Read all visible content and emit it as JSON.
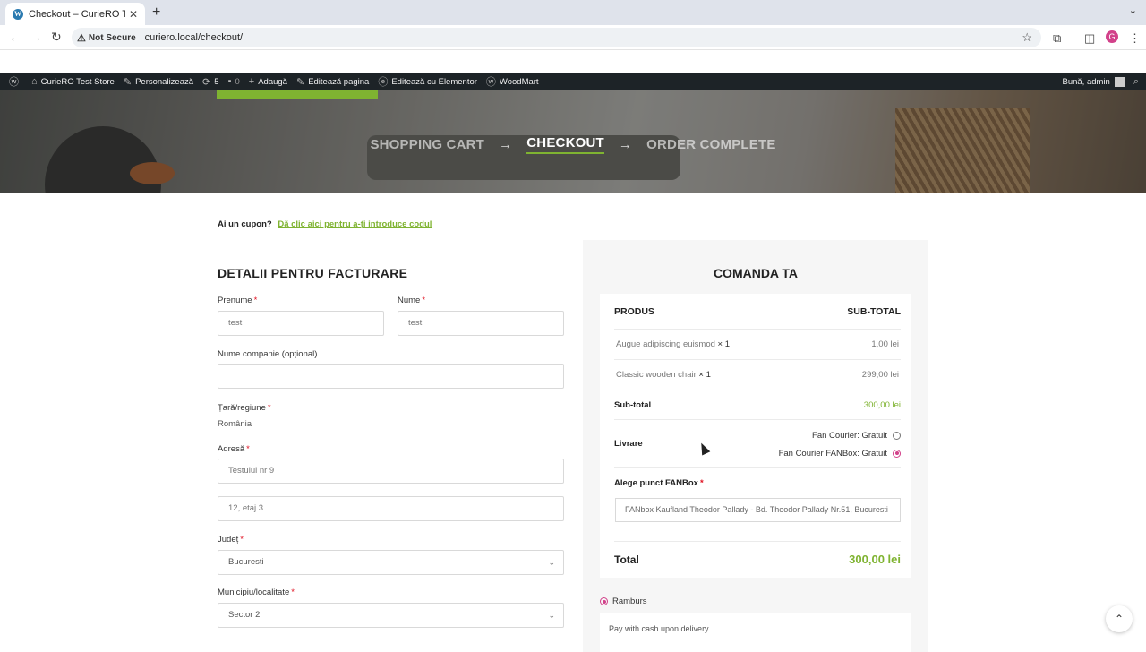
{
  "browser": {
    "tab_title": "Checkout – CurieRO Test Store",
    "security": "Not Secure",
    "url": "curiero.local/checkout/",
    "profile_initial": "G"
  },
  "wpbar": {
    "site": "CurieRO Test Store",
    "customize": "Personalizează",
    "updates": "5",
    "comments": "0",
    "add": "Adaugă",
    "edit_page": "Editează pagina",
    "edit_elementor": "Editează cu Elementor",
    "woodmart": "WoodMart",
    "greeting": "Bună, admin"
  },
  "hero": {
    "step1": "SHOPPING CART",
    "step2": "CHECKOUT",
    "step3": "ORDER COMPLETE",
    "arrow": "→"
  },
  "coupon": {
    "question": "Ai un cupon?",
    "link": "Dă clic aici pentru a-ți introduce codul"
  },
  "billing": {
    "title": "DETALII PENTRU FACTURARE",
    "first_name_label": "Prenume",
    "first_name": "test",
    "last_name_label": "Nume",
    "last_name": "test",
    "company_label": "Nume companie (opțional)",
    "company": "",
    "country_label": "Țară/regiune",
    "country": "România",
    "address_label": "Adresă",
    "address1": "Testului nr 9",
    "address2": "12, etaj 3",
    "county_label": "Județ",
    "county": "Bucuresti",
    "city_label": "Municipiu/localitate",
    "city": "Sector 2",
    "required_mark": "*"
  },
  "order": {
    "title": "COMANDA TA",
    "col_product": "PRODUS",
    "col_subtotal": "SUB-TOTAL",
    "items": [
      {
        "name": "Augue adipiscing euismod",
        "qty": "× 1",
        "price": "1,00 lei"
      },
      {
        "name": "Classic wooden chair",
        "qty": "× 1",
        "price": "299,00 lei"
      }
    ],
    "subtotal_label": "Sub-total",
    "subtotal": "300,00 lei",
    "shipping_label": "Livrare",
    "shipping_opt1": "Fan Courier: Gratuit",
    "shipping_opt2": "Fan Courier FANBox: Gratuit",
    "fanbox_label": "Alege punct FANBox",
    "fanbox_value": "FANbox Kaufland Theodor Pallady - Bd. Theodor Pallady Nr.51, Bucuresti",
    "total_label": "Total",
    "total": "300,00 lei",
    "payment_method": "Ramburs",
    "payment_desc": "Pay with cash upon delivery."
  },
  "colors": {
    "accent_green": "#7fb331",
    "radio_pink": "#d2418a",
    "wpbar_bg": "#1d2327"
  }
}
